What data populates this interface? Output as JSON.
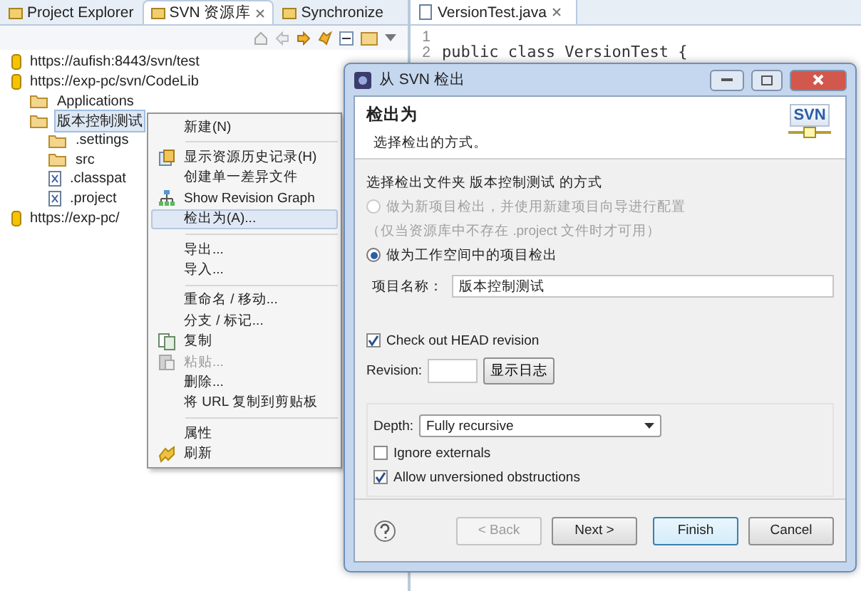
{
  "left_panel": {
    "tabs": [
      {
        "label": "Project Explorer",
        "selected": false,
        "closable": false
      },
      {
        "label": "SVN 资源库",
        "selected": true,
        "closable": true
      },
      {
        "label": "Synchronize",
        "selected": false,
        "closable": false
      }
    ],
    "tree": [
      {
        "label": "https://aufish:8443/svn/test",
        "kind": "repository",
        "selected": false
      },
      {
        "label": "https://exp-pc/svn/CodeLib",
        "kind": "repository",
        "selected": false,
        "children": [
          {
            "label": "Applications",
            "kind": "folder",
            "selected": false
          },
          {
            "label": "版本控制测试",
            "kind": "folder",
            "selected": true,
            "children": [
              {
                "label": ".settings",
                "kind": "folder",
                "selected": false
              },
              {
                "label": "src",
                "kind": "folder",
                "selected": false
              },
              {
                "label": ".classpat",
                "kind": "file",
                "selected": false
              },
              {
                "label": ".project",
                "kind": "file",
                "selected": false
              }
            ]
          }
        ]
      },
      {
        "label": "https://exp-pc/",
        "kind": "repository",
        "selected": false
      }
    ]
  },
  "editor": {
    "tab": "VersionTest.java",
    "lines": [
      {
        "number": "1"
      },
      {
        "number": "2",
        "code": "public class VersionTest {"
      }
    ]
  },
  "context_menu": [
    {
      "kind": "item",
      "label": "新建(N)",
      "selected": false,
      "disabled": false
    },
    {
      "kind": "separator"
    },
    {
      "kind": "item",
      "label": "显示资源历史记录(H)",
      "selected": false,
      "disabled": false
    },
    {
      "kind": "item",
      "label": "创建单一差异文件",
      "selected": false,
      "disabled": false
    },
    {
      "kind": "item",
      "label": "Show Revision Graph",
      "selected": false,
      "disabled": false
    },
    {
      "kind": "item",
      "label": "检出为(A)...",
      "selected": true,
      "disabled": false
    },
    {
      "kind": "separator"
    },
    {
      "kind": "item",
      "label": "导出...",
      "selected": false,
      "disabled": false
    },
    {
      "kind": "item",
      "label": "导入...",
      "selected": false,
      "disabled": false
    },
    {
      "kind": "separator"
    },
    {
      "kind": "item",
      "label": "重命名 / 移动...",
      "selected": false,
      "disabled": false
    },
    {
      "kind": "item",
      "label": "分支 / 标记...",
      "selected": false,
      "disabled": false
    },
    {
      "kind": "item",
      "label": "复制",
      "selected": false,
      "disabled": false
    },
    {
      "kind": "item",
      "label": "粘贴...",
      "selected": false,
      "disabled": true
    },
    {
      "kind": "item",
      "label": "删除...",
      "selected": false,
      "disabled": false
    },
    {
      "kind": "item",
      "label": "将 URL 复制到剪贴板",
      "selected": false,
      "disabled": false
    },
    {
      "kind": "separator"
    },
    {
      "kind": "item",
      "label": "属性",
      "selected": false,
      "disabled": false
    },
    {
      "kind": "item",
      "label": "刷新",
      "selected": false,
      "disabled": false
    }
  ],
  "dialog": {
    "title": "从 SVN 检出",
    "heading": "检出为",
    "subtitle": "选择检出的方式。",
    "logo": "SVN",
    "group_label": "选择检出文件夹 版本控制测试 的方式",
    "modes": [
      {
        "label": "做为新项目检出，并使用新建项目向导进行配置",
        "selected": false,
        "disabled": true,
        "note": "（仅当资源库中不存在 .project 文件时才可用）"
      },
      {
        "label": "做为工作空间中的项目检出",
        "selected": true,
        "disabled": false
      }
    ],
    "project_name": {
      "label": "项目名称：",
      "value": "版本控制测试"
    },
    "head_revision": {
      "label": "Check out HEAD revision",
      "checked": true
    },
    "revision": {
      "label": "Revision:",
      "button": "显示日志"
    },
    "depth": {
      "label": "Depth:",
      "value": "Fully recursive"
    },
    "options": [
      {
        "label": "Ignore externals",
        "checked": false
      },
      {
        "label": "Allow unversioned obstructions",
        "checked": true
      }
    ],
    "buttons": [
      {
        "label": "< Back",
        "disabled": true,
        "default": false
      },
      {
        "label": "Next >",
        "disabled": false,
        "default": false
      },
      {
        "label": "Finish",
        "disabled": false,
        "default": true
      },
      {
        "label": "Cancel",
        "disabled": false,
        "default": false
      }
    ]
  }
}
